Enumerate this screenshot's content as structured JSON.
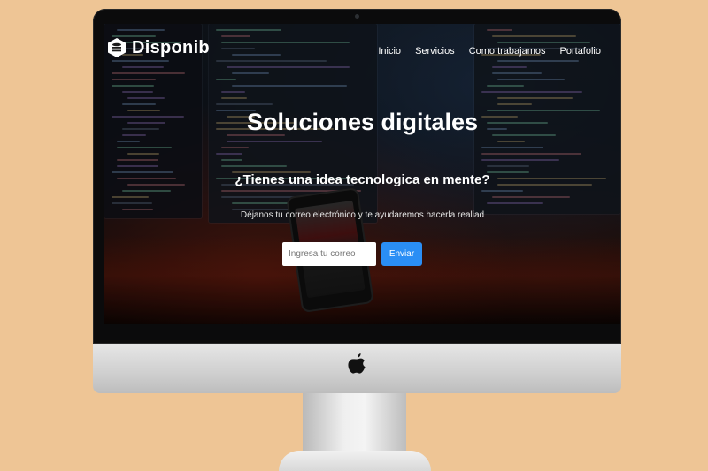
{
  "brand": {
    "logo_text": "Disponib"
  },
  "nav": {
    "items": [
      "Inicio",
      "Servicios",
      "Como trabajamos",
      "Portafolio"
    ]
  },
  "hero": {
    "title": "Soluciones digitales",
    "subtitle": "¿Tienes una idea tecnologica en mente?",
    "description": "Déjanos tu correo electrónico y te ayudaremos hacerla realiad"
  },
  "signup": {
    "placeholder": "Ingresa tu correo",
    "button_label": "Enviar"
  },
  "colors": {
    "page_background": "#eec595",
    "button": "#2a8ef5"
  },
  "icons": {
    "brand": "hexagon-database-icon",
    "device": "apple-logo-icon"
  }
}
